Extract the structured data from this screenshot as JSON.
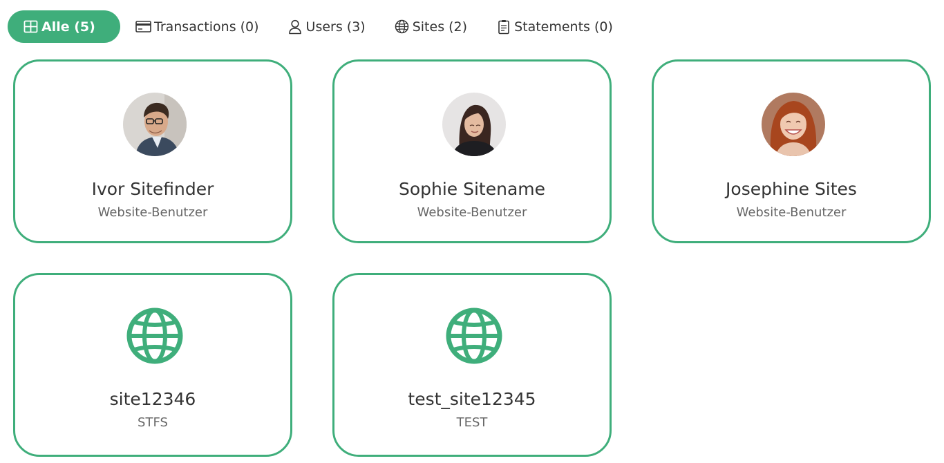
{
  "tabs": [
    {
      "label": "Alle (5)",
      "icon": "grid-icon",
      "active": true
    },
    {
      "label": "Transactions (0)",
      "icon": "credit-card-icon",
      "active": false
    },
    {
      "label": "Users (3)",
      "icon": "user-icon",
      "active": false
    },
    {
      "label": "Sites (2)",
      "icon": "globe-icon",
      "active": false
    },
    {
      "label": "Statements (0)",
      "icon": "document-icon",
      "active": false
    }
  ],
  "users": [
    {
      "name": "Ivor Sitefinder",
      "role": "Website-Benutzer",
      "avatar": "avatar-photo-man-glasses"
    },
    {
      "name": "Sophie Sitename",
      "role": "Website-Benutzer",
      "avatar": "avatar-photo-woman-dark-hair"
    },
    {
      "name": "Josephine Sites",
      "role": "Website-Benutzer",
      "avatar": "avatar-photo-woman-red-hair"
    }
  ],
  "sites": [
    {
      "name": "site12346",
      "code": "STFS",
      "icon": "globe-icon"
    },
    {
      "name": "test_site12345",
      "code": "TEST",
      "icon": "globe-icon"
    }
  ],
  "colors": {
    "accent": "#3fae7b",
    "text": "#333333",
    "muted": "#666666"
  }
}
